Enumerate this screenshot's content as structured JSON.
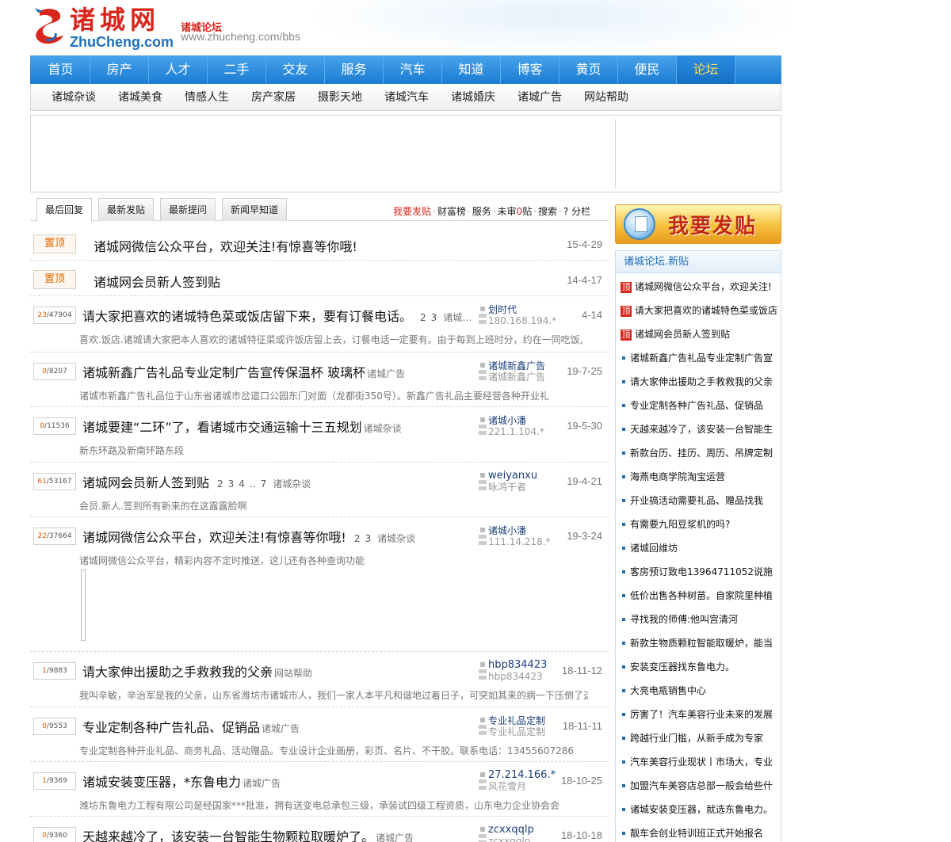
{
  "header": {
    "logo_cn": "诸城网",
    "logo_en": "ZhuCheng.com",
    "site_sub": "诸城论坛",
    "site_url": "www.zhucheng.com/bbs"
  },
  "nav": [
    "首页",
    "房产",
    "人才",
    "二手",
    "交友",
    "服务",
    "汽车",
    "知道",
    "博客",
    "黄页",
    "便民",
    "论坛"
  ],
  "nav_active": "论坛",
  "subnav": [
    "诸城杂谈",
    "诸城美食",
    "情感人生",
    "房产家居",
    "摄影天地",
    "诸城汽车",
    "诸城婚庆",
    "诸城广告",
    "网站帮助"
  ],
  "tabs": [
    "最后回复",
    "最新发贴",
    "最新提问",
    "新闻早知道"
  ],
  "tools": {
    "post": "我要发贴",
    "rich": "财富榜",
    "service": "服务",
    "unreviewed_pre": "未审",
    "unreviewed_count": "0",
    "unreviewed_post": "贴",
    "search": "搜索",
    "column": "分栏"
  },
  "rows": [
    {
      "pin": "置顶",
      "title": "诸城网微信公众平台，欢迎关注!有惊喜等你哦!",
      "date": "15-4-29"
    },
    {
      "pin": "置顶",
      "title": "诸城网会员新人签到贴",
      "date": "14-4-17"
    },
    {
      "replies": "23",
      "views": "47904",
      "title": "请大家把喜欢的诸城特色菜或饭店留下来，要有订餐电话。",
      "pages": [
        "2",
        "3"
      ],
      "cat": "诸城…",
      "author": "划时代",
      "ip": "180.168.194.*",
      "date": "4-14",
      "excerpt": "喜欢.饭店.诸城请大家把本人喜欢的诸城特征菜或许饭店留上去，订餐电话一定要有。由于每到上班时分，约在一同吃饭,"
    },
    {
      "replies": "0",
      "views": "8207",
      "title": "诸城新鑫广告礼品专业定制广告宣传保温杯 玻璃杯",
      "cat": "诸城广告",
      "author": "诸城新鑫广告",
      "ip": "诸城新鑫广告",
      "date": "19-7-25",
      "excerpt": "诸城市新鑫广告礼品位于山东省诸城市岔道口公园东门对面（龙都街350号）。新鑫广告礼品主要经营各种开业礼"
    },
    {
      "replies": "0",
      "views": "11536",
      "title": "诸城要建“二环”了，看诸城市交通运输十三五规划",
      "cat": "诸城杂谈",
      "author": "诸城小潘",
      "ip": "221.1.104.*",
      "date": "19-5-30",
      "excerpt": "新东环路及新南环路东段"
    },
    {
      "replies": "61",
      "views": "53167",
      "title": "诸城网会员新人签到贴",
      "pages": [
        "2",
        "3",
        "4",
        "..",
        "7"
      ],
      "cat": "诸城杂谈",
      "author": "weiyanxu",
      "ip": "昹鸿干者",
      "date": "19-4-21",
      "excerpt": "会员.新人.签到所有新来的在这露露脸啊"
    },
    {
      "replies": "22",
      "views": "37664",
      "title": "诸城网微信公众平台，欢迎关注!有惊喜等你哦!",
      "pages": [
        "2",
        "3"
      ],
      "cat": "诸城杂谈",
      "author": "诸城小潘",
      "ip": "111.14.218.*",
      "date": "19-3-24",
      "excerpt": "诸城网微信公众平台，精彩内容不定时推送，这儿还有各种查询功能"
    },
    {
      "replies": "1",
      "views": "9883",
      "title": "请大家伸出援助之手救救我的父亲",
      "cat": "网站帮助",
      "author": "hbp834423",
      "ip": "hbp834423",
      "date": "18-11-12",
      "excerpt": "我叫辛敏，辛治军是我的父亲，山东省潍坊市诸城市人，我们一家人本平凡和谐地过着日子，可突如其来的病一下压倒了这"
    },
    {
      "replies": "0",
      "views": "9553",
      "title": "专业定制各种广告礼品、促销品",
      "cat": "诸城广告",
      "author": "专业礼品定制",
      "ip": "专业礼品定制",
      "date": "18-11-11",
      "excerpt": "专业定制各种开业礼品、商务礼品、活动赠品。专业设计企业画册，彩页、名片、不干胶。联系电话：13455607286"
    },
    {
      "replies": "1",
      "views": "9369",
      "title": "诸城安装变压器，*东鲁电力",
      "cat": "诸城广告",
      "author": "27.214.166.*",
      "ip": "风花雪月",
      "date": "18-10-25",
      "excerpt": "潍坊东鲁电力工程有限公司是经国家***批准，拥有送变电总承包三级，承装试四级工程资质，山东电力企业协会会"
    },
    {
      "replies": "0",
      "views": "9360",
      "title": "天越来越冷了，该安装一台智能生物颗粒取暖炉了。",
      "cat": "诸城广告",
      "author": "zcxxqqlp",
      "ip": "zcxxqqlp",
      "date": "18-10-18",
      "excerpt": ""
    }
  ],
  "post_button": "我要发贴",
  "side": {
    "title": "诸城论坛.新贴",
    "ding": "顶",
    "items": [
      {
        "pinned": true,
        "text": "诸城网微信公众平台，欢迎关注!"
      },
      {
        "pinned": true,
        "text": "请大家把喜欢的诸城特色菜或饭店"
      },
      {
        "pinned": true,
        "text": "诸城网会员新人签到贴"
      },
      {
        "pinned": false,
        "text": "诸城新鑫广告礼品专业定制广告宣"
      },
      {
        "pinned": false,
        "text": "请大家伸出援助之手救救我的父亲"
      },
      {
        "pinned": false,
        "text": "专业定制各种广告礼品、促销品"
      },
      {
        "pinned": false,
        "text": "天越来越冷了，该安装一台智能生"
      },
      {
        "pinned": false,
        "text": "新款台历、挂历、周历、吊牌定制"
      },
      {
        "pinned": false,
        "text": "海燕电商学院淘宝运营"
      },
      {
        "pinned": false,
        "text": "开业搞活动需要礼品、赠品找我"
      },
      {
        "pinned": false,
        "text": "有需要九阳豆浆机的吗?"
      },
      {
        "pinned": false,
        "text": "诸城回维坊"
      },
      {
        "pinned": false,
        "text": "客房预订致电13964711052说施"
      },
      {
        "pinned": false,
        "text": "低价出售各种树苗。自家院里种植"
      },
      {
        "pinned": false,
        "text": "寻找我的师傅:他叫宫清河"
      },
      {
        "pinned": false,
        "text": "新款生物质颗粒智能取暖炉，能当"
      },
      {
        "pinned": false,
        "text": "安装变压器找东鲁电力。"
      },
      {
        "pinned": false,
        "text": "大亮电瓶销售中心"
      },
      {
        "pinned": false,
        "text": "厉害了！汽车美容行业未来的发展"
      },
      {
        "pinned": false,
        "text": "跨越行业门槛，从新手成为专家"
      },
      {
        "pinned": false,
        "text": "汽车美容行业现状丨市场大，专业"
      },
      {
        "pinned": false,
        "text": "加盟汽车美容店总部一般会给些什"
      },
      {
        "pinned": false,
        "text": "诸城安装变压器，就选东鲁电力。"
      },
      {
        "pinned": false,
        "text": "靓车会创业特训班正式开始报名"
      }
    ]
  }
}
